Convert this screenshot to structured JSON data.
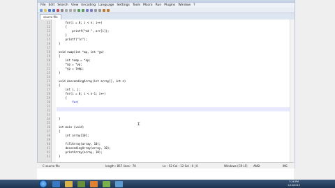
{
  "menu": [
    "File",
    "Edit",
    "Search",
    "View",
    "Encoding",
    "Language",
    "Settings",
    "Tools",
    "Macro",
    "Run",
    "Plugins",
    "Window",
    "?"
  ],
  "tab": "source file",
  "code_lines": [
    {
      "n": "11",
      "text": "    for(i = 0; i < n; i++)"
    },
    {
      "n": "12",
      "text": "    {"
    },
    {
      "n": "13",
      "text": "        printf(\"%d \", arr[i]);"
    },
    {
      "n": "14",
      "text": "    }"
    },
    {
      "n": "15",
      "text": "    printf(\"\\n\");"
    },
    {
      "n": "16",
      "text": "}"
    },
    {
      "n": "17",
      "text": ""
    },
    {
      "n": "18",
      "text": "void swap(int *ap, int *yp)"
    },
    {
      "n": "19",
      "text": "{"
    },
    {
      "n": "20",
      "text": "    int temp = *ap;"
    },
    {
      "n": "21",
      "text": "    *ap = *yp;"
    },
    {
      "n": "22",
      "text": "    *yp = temp;"
    },
    {
      "n": "23",
      "text": "}"
    },
    {
      "n": "24",
      "text": ""
    },
    {
      "n": "25",
      "text": "void descendingArray(int array[], int n)"
    },
    {
      "n": "26",
      "text": "{"
    },
    {
      "n": "27",
      "text": "    int i, j;"
    },
    {
      "n": "28",
      "text": "    for(i = 0; i < n-1; i++)"
    },
    {
      "n": "29",
      "text": "    {"
    },
    {
      "n": "30",
      "text": "        for("
    },
    {
      "n": "31",
      "text": ""
    },
    {
      "n": "32",
      "text": ""
    },
    {
      "n": "33",
      "text": ""
    },
    {
      "n": "34",
      "text": "}"
    },
    {
      "n": "35",
      "text": ""
    },
    {
      "n": "36",
      "text": "int main (void)"
    },
    {
      "n": "37",
      "text": "{"
    },
    {
      "n": "38",
      "text": "    int array[10];"
    },
    {
      "n": "39",
      "text": ""
    },
    {
      "n": "40",
      "text": "    fillArray(array, 10);"
    },
    {
      "n": "41",
      "text": "    descendingArray(array, 10);"
    },
    {
      "n": "42",
      "text": "    printArray(array, 10);"
    },
    {
      "n": "43",
      "text": "}"
    }
  ],
  "status": {
    "file_type": "C source file",
    "length": "length : 857    lines : 70",
    "position": "Ln : 52    Col : 12    Sel : 0 | 0",
    "eol": "Windows (CR LF)",
    "encoding": "ANSI",
    "mode": "INS"
  },
  "clock": {
    "time": "7:26 PM",
    "date": "1/14/2015"
  }
}
